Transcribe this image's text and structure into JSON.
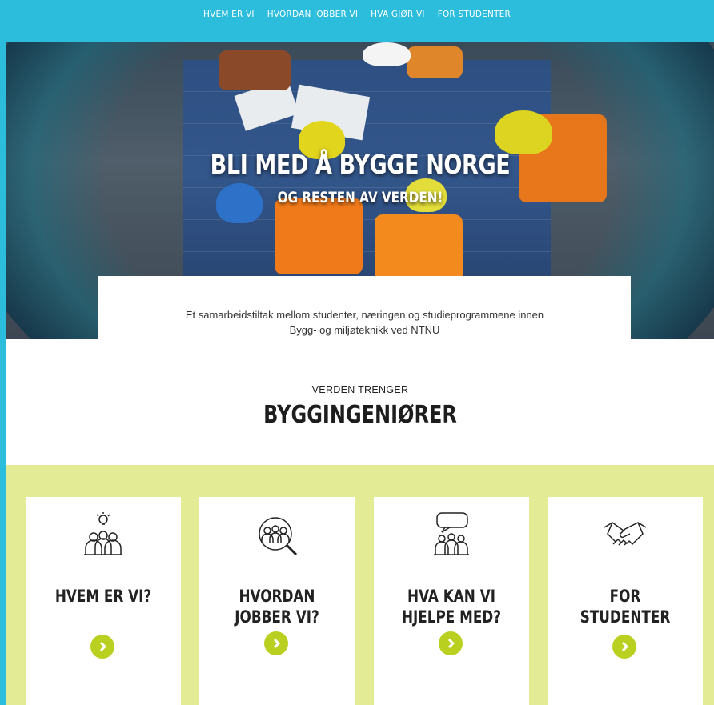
{
  "nav": {
    "items": [
      "HVEM ER VI",
      "HVORDAN JOBBER VI",
      "HVA GJØR VI",
      "FOR STUDENTER"
    ]
  },
  "hero": {
    "title": "BLI MED Å BYGGE NORGE",
    "subtitle": "OG RESTEN AV VERDEN!"
  },
  "intro": {
    "line1": "Et samarbeidstiltak mellom studenter, næringen og studieprogrammene innen",
    "line2": "Bygg- og miljøteknikk ved NTNU"
  },
  "section": {
    "kicker": "VERDEN TRENGER",
    "headline": "BYGGINGENIØRER"
  },
  "cards": [
    {
      "title_line1": "HVEM ER VI?",
      "title_line2": "",
      "icon": "team-idea-icon"
    },
    {
      "title_line1": "HVORDAN",
      "title_line2": "JOBBER VI?",
      "icon": "team-search-icon"
    },
    {
      "title_line1": "HVA KAN VI",
      "title_line2": "HJELPE MED?",
      "icon": "team-chat-icon"
    },
    {
      "title_line1": "FOR STUDENTER",
      "title_line2": "",
      "icon": "handshake-icon"
    }
  ],
  "colors": {
    "nav_bg": "#2cbcdc",
    "band_bg": "#e3ec94",
    "arrow_bg": "#b9d021"
  }
}
